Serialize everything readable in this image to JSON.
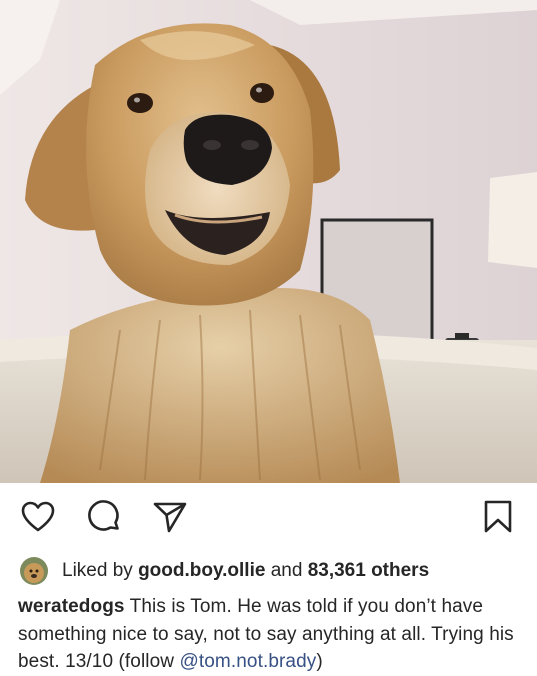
{
  "post": {
    "image_alt": "Golden retriever looking at the camera",
    "likes": {
      "prefix": "Liked by",
      "user": "good.boy.ollie",
      "middle": "and",
      "count_text": "83,361 others"
    },
    "caption": {
      "username": "weratedogs",
      "text": "This is Tom. He was told if you don’t have something nice to say, not to say anything at all. Trying his best. 13/10 (follow",
      "mention": "@tom.not.brady",
      "closing": ")"
    }
  },
  "icons": {
    "like": "heart-icon",
    "comment": "comment-bubble-icon",
    "share": "paper-plane-icon",
    "save": "bookmark-icon"
  },
  "colors": {
    "text": "#262626",
    "link": "#385185",
    "background": "#ffffff"
  }
}
